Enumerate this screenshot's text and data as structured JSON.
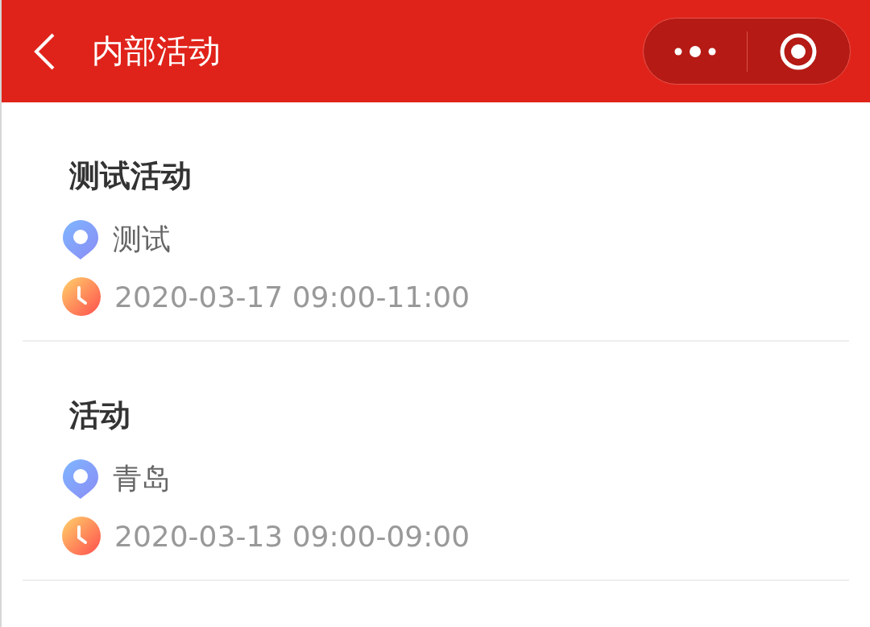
{
  "header": {
    "title": "内部活动"
  },
  "activities": [
    {
      "title": "测试活动",
      "location": "测试",
      "time": "2020-03-17 09:00-11:00"
    },
    {
      "title": "活动",
      "location": "青岛",
      "time": "2020-03-13 09:00-09:00"
    }
  ]
}
